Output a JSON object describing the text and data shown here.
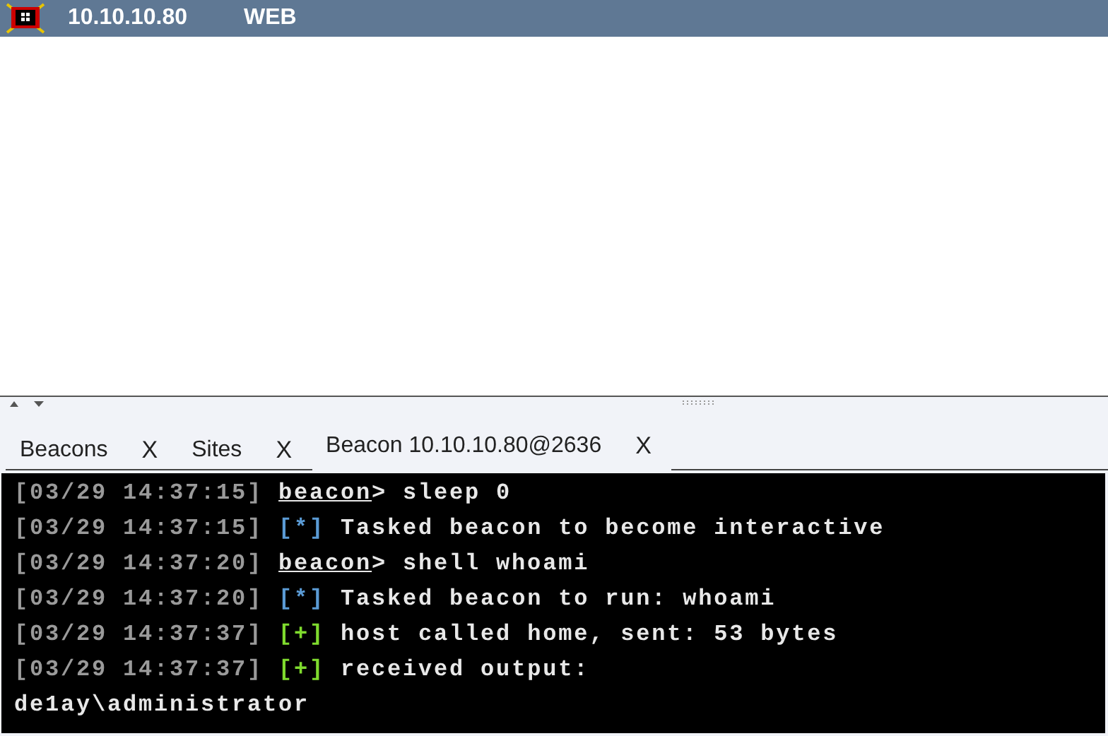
{
  "header": {
    "host": "10.10.10.80",
    "name": "WEB"
  },
  "tabs": [
    {
      "label": "Beacons",
      "close": "X",
      "selected": false
    },
    {
      "label": "Sites",
      "close": "X",
      "selected": false
    },
    {
      "label": "Beacon 10.10.10.80@2636",
      "close": "X",
      "selected": true
    }
  ],
  "console": {
    "lines": [
      {
        "kind": "command",
        "time": "[03/29 14:37:15]",
        "prompt": "beacon",
        "text": "> sleep 0"
      },
      {
        "kind": "info",
        "time": "[03/29 14:37:15]",
        "tag": "[*]",
        "text": "Tasked beacon to become interactive"
      },
      {
        "kind": "command",
        "time": "[03/29 14:37:20]",
        "prompt": "beacon",
        "text": "> shell whoami"
      },
      {
        "kind": "info",
        "time": "[03/29 14:37:20]",
        "tag": "[*]",
        "text": "Tasked beacon to run: whoami"
      },
      {
        "kind": "success",
        "time": "[03/29 14:37:37]",
        "tag": "[+]",
        "text": "host called home, sent: 53 bytes"
      },
      {
        "kind": "success",
        "time": "[03/29 14:37:37]",
        "tag": "[+]",
        "text": "received output:"
      },
      {
        "kind": "output",
        "text": "de1ay\\administrator"
      }
    ]
  }
}
